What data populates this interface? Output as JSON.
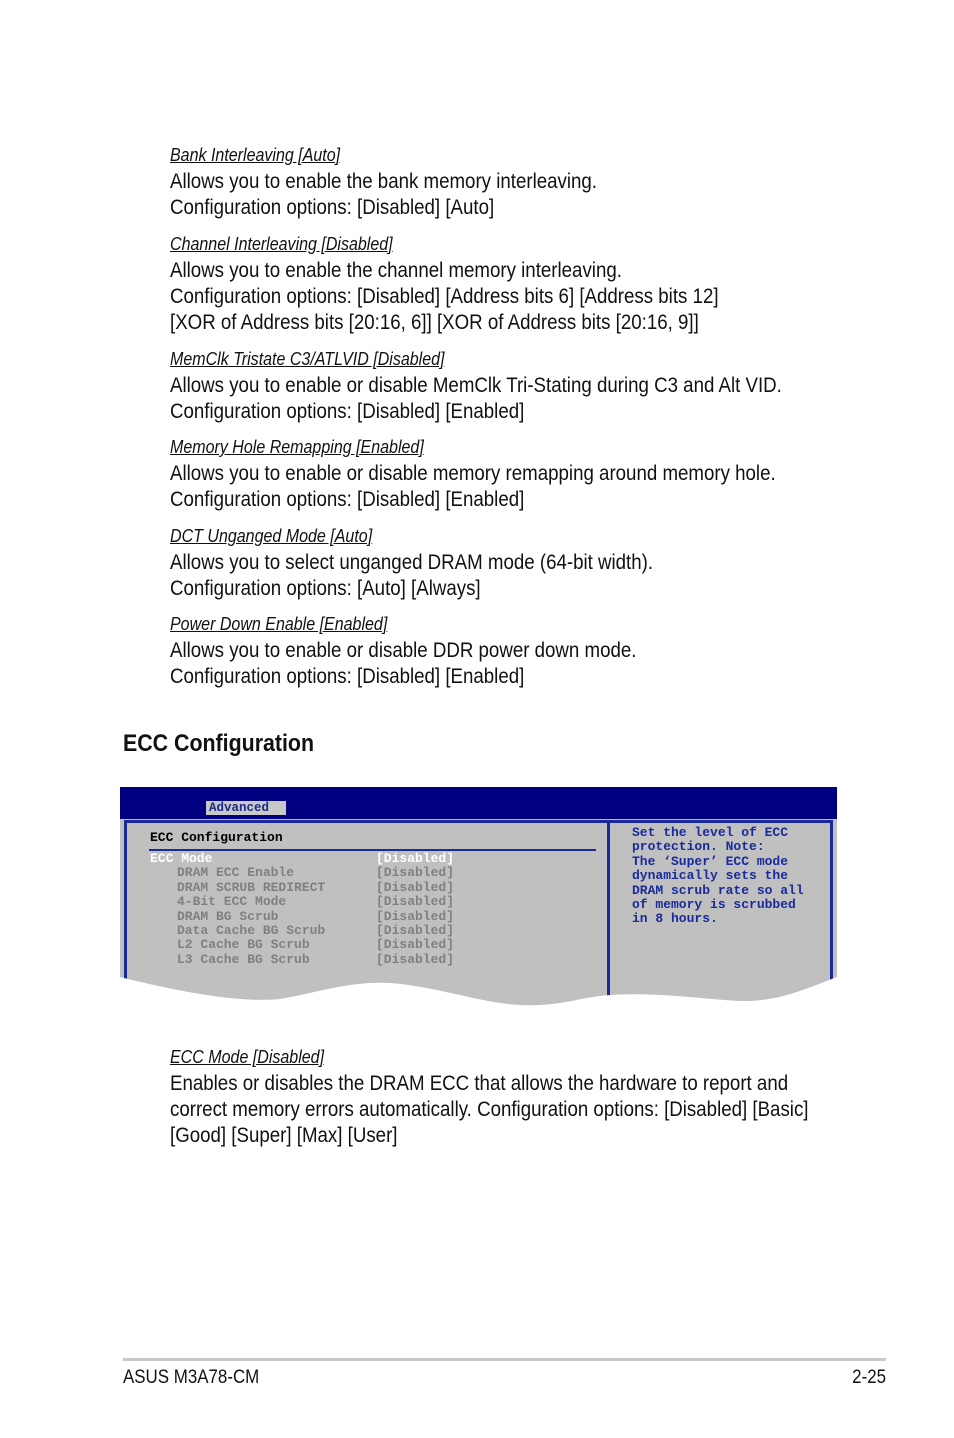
{
  "sections": [
    {
      "heading": "Bank Interleaving [Auto]",
      "lines": [
        "Allows you to enable the bank memory interleaving.",
        "Configuration options: [Disabled] [Auto]"
      ]
    },
    {
      "heading": "Channel Interleaving [Disabled]",
      "lines": [
        "Allows you to enable the channel memory interleaving.",
        "Configuration options: [Disabled] [Address bits 6] [Address bits 12]",
        "[XOR of Address bits [20:16, 6]] [XOR of Address bits [20:16, 9]]"
      ]
    },
    {
      "heading": "MemClk Tristate C3/ATLVID [Disabled]",
      "lines": [
        "Allows you to enable or disable MemClk Tri-Stating during C3 and Alt VID.",
        "Configuration options: [Disabled] [Enabled]"
      ]
    },
    {
      "heading": "Memory Hole Remapping [Enabled]",
      "lines": [
        "Allows you to enable or disable memory remapping around memory hole.",
        "Configuration options: [Disabled] [Enabled]"
      ]
    },
    {
      "heading": "DCT Unganged Mode [Auto]",
      "lines": [
        "Allows you to select unganged DRAM mode (64-bit width).",
        "Configuration options: [Auto] [Always]"
      ]
    },
    {
      "heading": "Power Down Enable [Enabled]",
      "lines": [
        "Allows you to enable or disable DDR power down mode.",
        "Configuration options: [Disabled] [Enabled]"
      ]
    }
  ],
  "ecc_title": "ECC Configuration",
  "bios": {
    "tab": "Advanced",
    "panel_title": "ECC Configuration",
    "items": [
      {
        "label": "ECC Mode",
        "value": "[Disabled]",
        "selected": true
      },
      {
        "label": "DRAM ECC Enable",
        "value": "[Disabled]"
      },
      {
        "label": "DRAM SCRUB REDIRECT",
        "value": "[Disabled]"
      },
      {
        "label": "4-Bit ECC Mode",
        "value": "[Disabled]"
      },
      {
        "label": "DRAM BG Scrub",
        "value": "[Disabled]"
      },
      {
        "label": "Data Cache BG Scrub",
        "value": "[Disabled]"
      },
      {
        "label": "L2 Cache BG Scrub",
        "value": "[Disabled]"
      },
      {
        "label": "L3 Cache BG Scrub",
        "value": "[Disabled]"
      }
    ],
    "help": [
      "Set the level of ECC",
      "protection. Note:",
      "The ‘Super’ ECC mode",
      "dynamically sets the",
      "DRAM scrub rate so all",
      "of memory is scrubbed",
      "in 8 hours."
    ],
    "colors": {
      "bar": "#000080",
      "panel": "#c0c0c0",
      "help_text": "#1a2a9a",
      "selected": "#ffffff",
      "item": "#808080"
    }
  },
  "ecc_mode": {
    "heading": "ECC Mode [Disabled]",
    "lines": [
      "Enables or disables the DRAM ECC that allows the hardware to report and",
      "correct memory errors automatically. Configuration options: [Disabled] [Basic]",
      "[Good] [Super] [Max] [User]"
    ]
  },
  "footer": {
    "left": "ASUS M3A78-CM",
    "right": "2-25"
  }
}
